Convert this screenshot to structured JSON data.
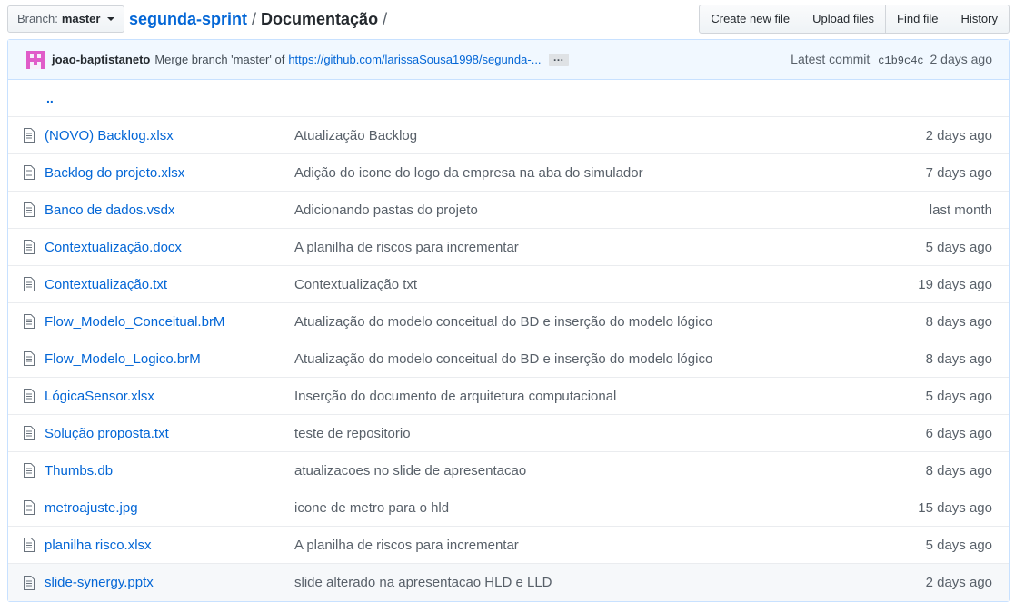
{
  "branch": {
    "prefix": "Branch:",
    "name": "master"
  },
  "breadcrumb": {
    "repo": "segunda-sprint",
    "separator": "/",
    "current": "Documentação",
    "trailing": "/"
  },
  "actions": {
    "create": "Create new file",
    "upload": "Upload files",
    "find": "Find file",
    "history": "History"
  },
  "commit": {
    "author": "joao-baptistaneto",
    "message": "Merge branch 'master' of",
    "link": "https://github.com/larissaSousa1998/segunda-...",
    "ellipsis": "…",
    "latest_label": "Latest commit",
    "sha": "c1b9c4c",
    "age": "2 days ago"
  },
  "up_dir": "..",
  "files": [
    {
      "name": "(NOVO) Backlog.xlsx",
      "message": "Atualização Backlog",
      "age": "2 days ago"
    },
    {
      "name": "Backlog do projeto.xlsx",
      "message": "Adição do icone do logo da empresa na aba do simulador",
      "age": "7 days ago"
    },
    {
      "name": "Banco de dados.vsdx",
      "message": "Adicionando pastas do projeto",
      "age": "last month"
    },
    {
      "name": "Contextualização.docx",
      "message": "A planilha de riscos para incrementar",
      "age": "5 days ago"
    },
    {
      "name": "Contextualização.txt",
      "message": "Contextualização txt",
      "age": "19 days ago"
    },
    {
      "name": "Flow_Modelo_Conceitual.brM",
      "message": "Atualização do modelo conceitual do BD e inserção do modelo lógico",
      "age": "8 days ago"
    },
    {
      "name": "Flow_Modelo_Logico.brM",
      "message": "Atualização do modelo conceitual do BD e inserção do modelo lógico",
      "age": "8 days ago"
    },
    {
      "name": "LógicaSensor.xlsx",
      "message": "Inserção do documento de arquitetura computacional",
      "age": "5 days ago"
    },
    {
      "name": "Solução proposta.txt",
      "message": "teste de repositorio",
      "age": "6 days ago"
    },
    {
      "name": "Thumbs.db",
      "message": "atualizacoes no slide de apresentacao",
      "age": "8 days ago"
    },
    {
      "name": "metroajuste.jpg",
      "message": "icone de metro para o hld",
      "age": "15 days ago"
    },
    {
      "name": "planilha risco.xlsx",
      "message": "A planilha de riscos para incrementar",
      "age": "5 days ago"
    },
    {
      "name": "slide-synergy.pptx",
      "message": "slide alterado na apresentacao HLD e LLD",
      "age": "2 days ago"
    }
  ],
  "colors": {
    "link": "#0366d6",
    "commit_bg": "#f1f8ff",
    "avatar": "#e05cc9"
  }
}
